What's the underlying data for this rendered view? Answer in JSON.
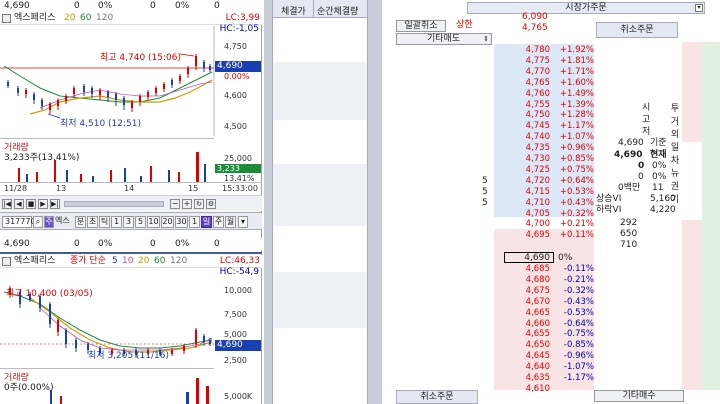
{
  "top_chart": {
    "row1": {
      "price": "4,690",
      "v1": "0",
      "pct1": "0%",
      "v2": "0",
      "pct2": "0%",
      "v3": "0"
    },
    "legend": {
      "name": "엑스페리스",
      "ma": [
        "20",
        "60",
        "120"
      ],
      "lc": "LC:3,99",
      "hc": "HC:-1,05"
    },
    "y_labels": [
      "4,750",
      "4,700",
      "4,690",
      "0.00%",
      "4,600",
      "4,500"
    ],
    "current_price": "4,690",
    "high_label": "최고 4,740 (15:06)",
    "low_label": "최저 4,510 (12:51)",
    "volume_title": "거래량",
    "volume_value": "3,233주(13.41%)",
    "vol_axis": [
      "25,000",
      "3,233",
      "13.41%"
    ],
    "dates": [
      "11/28",
      "13",
      "14",
      "15"
    ],
    "time": "15:33:00"
  },
  "toolbar": {
    "code": "317770",
    "name": "엑스",
    "buttons": [
      "분",
      "초",
      "틱",
      "1",
      "3",
      "5",
      "10",
      "20",
      "30",
      "1"
    ],
    "selected": "일",
    "extra": [
      "주",
      "월"
    ]
  },
  "bottom_chart": {
    "row1": {
      "price": "4,690",
      "v1": "0",
      "pct1": "0%",
      "v2": "0",
      "pct2": "0%",
      "v3": "0"
    },
    "legend": {
      "name": "엑스페리스",
      "kind": "종가 단순",
      "ma": [
        "5",
        "10",
        "20",
        "60",
        "120"
      ],
      "lc": "LC:46,33",
      "hc": "HC:-54,9"
    },
    "y_labels": [
      "10,000",
      "7,500",
      "5,000",
      "4,690",
      "2,500"
    ],
    "current_price": "4,690",
    "high_label": "최고 10,400 (03/05)",
    "low_label": "최저 3,205 (11/16)",
    "volume_title": "거래량",
    "volume_value": "0주(0.00%)",
    "vol_axis": [
      "5,000K"
    ]
  },
  "middle": {
    "headers": [
      "체결가",
      "순간체결량"
    ]
  },
  "orderbook": {
    "title": "시장가주문",
    "btn_cancel_all": "일괄취소",
    "limit_up_label": "상한",
    "limit_up": "6,090",
    "other_sell": "기타매도",
    "first_price": "4,765",
    "cancel_order": "취소주문",
    "asks": [
      {
        "price": "4,780",
        "pct": "+1.92%"
      },
      {
        "price": "4,775",
        "pct": "+1.81%"
      },
      {
        "price": "4,770",
        "pct": "+1.71%"
      },
      {
        "price": "4,765",
        "pct": "+1.60%"
      },
      {
        "price": "4,760",
        "pct": "+1.49%"
      },
      {
        "price": "4,755",
        "pct": "+1.39%"
      },
      {
        "price": "4,750",
        "pct": "+1.28%"
      },
      {
        "price": "4,745",
        "pct": "+1.17%"
      },
      {
        "price": "4,740",
        "pct": "+1.07%"
      },
      {
        "price": "4,735",
        "pct": "+0.96%"
      },
      {
        "price": "4,730",
        "pct": "+0.85%"
      },
      {
        "price": "4,725",
        "pct": "+0.75%"
      },
      {
        "price": "4,720",
        "pct": "+0.64%",
        "qty": "5"
      },
      {
        "price": "4,715",
        "pct": "+0.53%",
        "qty": "5"
      },
      {
        "price": "4,710",
        "pct": "+0.43%",
        "qty": "5"
      },
      {
        "price": "4,705",
        "pct": "+0.32%"
      },
      {
        "price": "4,700",
        "pct": "+0.21%"
      },
      {
        "price": "4,695",
        "pct": "+0.11%"
      }
    ],
    "current": {
      "price": "4,690",
      "pct": "0%"
    },
    "bids": [
      {
        "price": "4,685",
        "pct": "-0.11%"
      },
      {
        "price": "4,680",
        "pct": "-0.21%"
      },
      {
        "price": "4,675",
        "pct": "-0.32%"
      },
      {
        "price": "4,670",
        "pct": "-0.43%"
      },
      {
        "price": "4,665",
        "pct": "-0.53%"
      },
      {
        "price": "4,660",
        "pct": "-0.64%"
      },
      {
        "price": "4,655",
        "pct": "-0.75%"
      },
      {
        "price": "4,650",
        "pct": "-0.85%"
      },
      {
        "price": "4,645",
        "pct": "-0.96%"
      },
      {
        "price": "4,640",
        "pct": "-1.07%"
      },
      {
        "price": "4,635",
        "pct": "-1.17%"
      },
      {
        "price": "4,610",
        "pct": ""
      }
    ],
    "side_qty": [
      "292",
      "650",
      "710"
    ],
    "info": {
      "labels_v": [
        "시",
        "고",
        "저"
      ],
      "base_price": "4,690",
      "base_label": "기준",
      "cur_price": "4,690",
      "cur_label": "현재",
      "zero1": "0",
      "zero1_pct": "0%",
      "zero2": "0",
      "zero2_pct": "0%",
      "baekman": "0백만",
      "baekman_n": "11",
      "upper_vi_label": "상승VI",
      "upper_vi": "5,160",
      "lower_vi_label": "하락VI",
      "lower_vi": "4,220"
    },
    "vtabs": [
      "투",
      "거",
      "외",
      "일",
      "차",
      "뉴",
      "권",
      "기"
    ],
    "other_buy": "기타매수",
    "bottom_cancel": "취소주문"
  }
}
